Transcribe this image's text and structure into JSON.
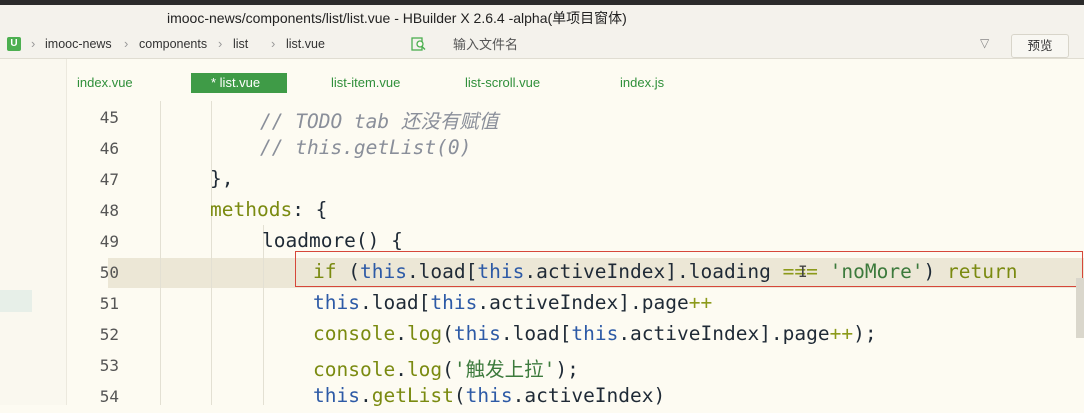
{
  "window": {
    "title": "imooc-news/components/list/list.vue - HBuilder X 2.6.4 -alpha(单项目窗体)"
  },
  "breadcrumb": [
    "imooc-news",
    "components",
    "list",
    "list.vue"
  ],
  "search": {
    "placeholder": "输入文件名"
  },
  "toolbar": {
    "preview_label": "预览"
  },
  "tabs": [
    {
      "label": "index.vue",
      "active": false
    },
    {
      "label": "* list.vue",
      "active": true
    },
    {
      "label": "list-item.vue",
      "active": false
    },
    {
      "label": "list-scroll.vue",
      "active": false
    },
    {
      "label": "index.js",
      "active": false
    }
  ],
  "editor": {
    "lines": [
      {
        "num": "45",
        "tokens": [
          {
            "t": "// TODO tab 还没有赋值",
            "c": "cm"
          }
        ]
      },
      {
        "num": "46",
        "tokens": [
          {
            "t": "// this.getList(0)",
            "c": "cm"
          }
        ]
      },
      {
        "num": "47",
        "tokens": [
          {
            "t": "},",
            "c": "pl"
          }
        ]
      },
      {
        "num": "48",
        "tokens": [
          {
            "t": "methods",
            "c": "fn"
          },
          {
            "t": ": {",
            "c": "pl"
          }
        ]
      },
      {
        "num": "49",
        "tokens": [
          {
            "t": "loadmore() {",
            "c": "pl"
          }
        ]
      },
      {
        "num": "50",
        "tokens": [
          {
            "t": "if",
            "c": "kw"
          },
          {
            "t": " (",
            "c": "pl"
          },
          {
            "t": "this",
            "c": "th"
          },
          {
            "t": ".load[",
            "c": "pl"
          },
          {
            "t": "this",
            "c": "th"
          },
          {
            "t": ".activeIndex].loading ",
            "c": "pl"
          },
          {
            "t": "===",
            "c": "op"
          },
          {
            "t": " ",
            "c": "pl"
          },
          {
            "t": "'noMore'",
            "c": "str"
          },
          {
            "t": ") ",
            "c": "pl"
          },
          {
            "t": "return",
            "c": "kw"
          }
        ]
      },
      {
        "num": "51",
        "tokens": [
          {
            "t": "this",
            "c": "th"
          },
          {
            "t": ".load[",
            "c": "pl"
          },
          {
            "t": "this",
            "c": "th"
          },
          {
            "t": ".activeIndex].page",
            "c": "pl"
          },
          {
            "t": "++",
            "c": "op"
          }
        ]
      },
      {
        "num": "52",
        "tokens": [
          {
            "t": "console",
            "c": "fn"
          },
          {
            "t": ".",
            "c": "pl"
          },
          {
            "t": "log",
            "c": "fn"
          },
          {
            "t": "(",
            "c": "pl"
          },
          {
            "t": "this",
            "c": "th"
          },
          {
            "t": ".load[",
            "c": "pl"
          },
          {
            "t": "this",
            "c": "th"
          },
          {
            "t": ".activeIndex].page",
            "c": "pl"
          },
          {
            "t": "++",
            "c": "op"
          },
          {
            "t": ");",
            "c": "pl"
          }
        ]
      },
      {
        "num": "53",
        "tokens": [
          {
            "t": "console",
            "c": "fn"
          },
          {
            "t": ".",
            "c": "pl"
          },
          {
            "t": "log",
            "c": "fn"
          },
          {
            "t": "(",
            "c": "pl"
          },
          {
            "t": "'触发上拉'",
            "c": "str"
          },
          {
            "t": ");",
            "c": "pl"
          }
        ]
      },
      {
        "num": "54",
        "tokens": [
          {
            "t": "this",
            "c": "th"
          },
          {
            "t": ".",
            "c": "pl"
          },
          {
            "t": "getList",
            "c": "fn"
          },
          {
            "t": "(",
            "c": "pl"
          },
          {
            "t": "this",
            "c": "th"
          },
          {
            "t": ".activeIndex)",
            "c": "pl"
          }
        ]
      }
    ]
  },
  "icons": {
    "logo": "hbuilder-logo-icon",
    "search": "search-file-icon",
    "filter": "filter-icon",
    "cursor": "text-cursor-icon"
  },
  "colors": {
    "accent": "#3f9b47",
    "highlight_border": "#d6473a",
    "keyword": "#7a8a10",
    "this": "#2d5aa6",
    "string": "#3c7a3c",
    "comment": "#8a8f9a"
  }
}
